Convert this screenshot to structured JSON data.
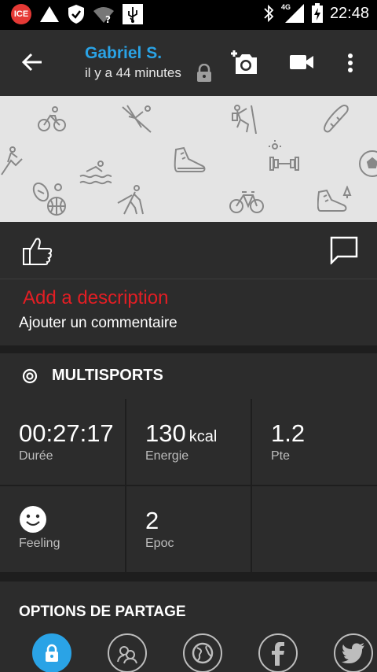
{
  "status_bar": {
    "carrier_badge": "ICE",
    "network": "4G",
    "time": "22:48"
  },
  "header": {
    "user_name": "Gabriel S.",
    "time_ago": "il y a 44 minutes"
  },
  "description": {
    "add_description": "Add a description",
    "add_comment": "Ajouter un commentaire"
  },
  "activity": {
    "sport": "MULTISPORTS",
    "stats": [
      {
        "value": "00:27:17",
        "unit": "",
        "label": "Durée"
      },
      {
        "value": "130",
        "unit": "kcal",
        "label": "Energie"
      },
      {
        "value": "1.2",
        "unit": "",
        "label": "Pte"
      },
      {
        "icon": "smiley-icon",
        "label": "Feeling"
      },
      {
        "value": "2",
        "unit": "",
        "label": "Epoc"
      }
    ]
  },
  "sharing": {
    "title": "OPTIONS DE PARTAGE",
    "options": [
      "lock-icon",
      "friends-icon",
      "globe-icon",
      "facebook-icon",
      "twitter-icon"
    ]
  },
  "colors": {
    "accent_blue": "#2aa3e6",
    "description_red": "#e31e24"
  }
}
